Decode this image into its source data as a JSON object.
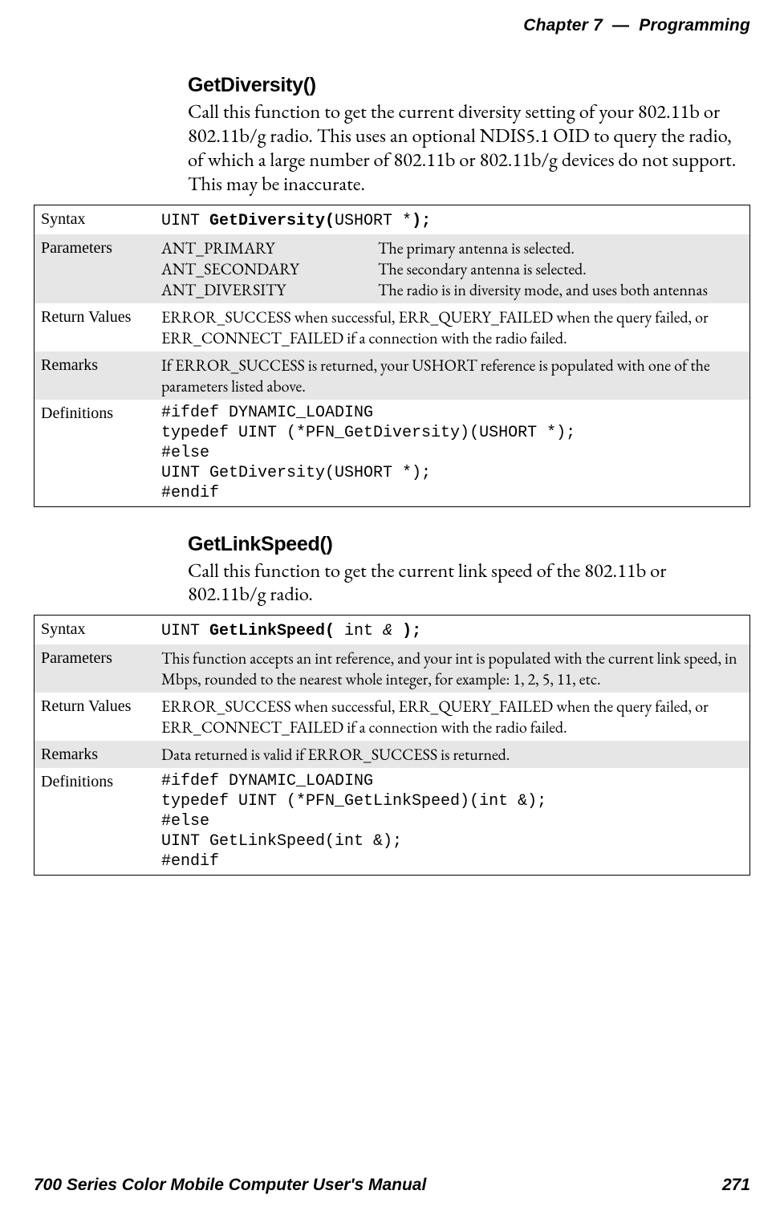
{
  "header": {
    "chapter_label": "Chapter",
    "chapter_num": "7",
    "dash": "—",
    "section": "Programming"
  },
  "func1": {
    "title": "GetDiversity()",
    "desc": "Call this function to get the current diversity setting of your 802.11b or 802.11b/g radio. This uses an optional NDIS5.1 OID to query the radio, of which a large number of 802.11b or 802.11b/g devices do not support. This may be inaccurate.",
    "rows": {
      "syntax_label": "Syntax",
      "syntax_pre": "UINT ",
      "syntax_bold1": "GetDiversity(",
      "syntax_mid": "USHORT *",
      "syntax_bold2": ");",
      "params_label": "Parameters",
      "params": [
        {
          "name": "ANT_PRIMARY",
          "desc": "The primary antenna is selected."
        },
        {
          "name": "ANT_SECONDARY",
          "desc": "The secondary antenna is selected."
        },
        {
          "name": "ANT_DIVERSITY",
          "desc": "The radio is in diversity mode, and uses both antennas"
        }
      ],
      "return_label": "Return Values",
      "return_text": "ERROR_SUCCESS when successful, ERR_QUERY_FAILED when the query failed, or ERR_CONNECT_FAILED if a connection with the radio failed.",
      "remarks_label": "Remarks",
      "remarks_text": "If ERROR_SUCCESS is returned, your USHORT reference is populated with one of the parameters listed above.",
      "defs_label": "Definitions",
      "defs_code": "#ifdef DYNAMIC_LOADING\ntypedef UINT (*PFN_GetDiversity)(USHORT *);\n#else\nUINT GetDiversity(USHORT *);\n#endif"
    }
  },
  "func2": {
    "title": "GetLinkSpeed()",
    "desc": "Call this function to get the current link speed of the 802.11b or 802.11b/g radio.",
    "rows": {
      "syntax_label": "Syntax",
      "syntax_pre": "UINT ",
      "syntax_bold1": "GetLinkSpeed(",
      "syntax_mid": " int ",
      "syntax_italic": "&",
      "syntax_space": " ",
      "syntax_bold2": ");",
      "params_label": "Parameters",
      "params_text": "This function accepts an int reference, and your int is populated with the current link speed, in Mbps, rounded to the nearest whole integer, for example: 1, 2, 5, 11, etc.",
      "return_label": "Return Values",
      "return_text": "ERROR_SUCCESS when successful, ERR_QUERY_FAILED when the query failed, or ERR_CONNECT_FAILED if a connection with the radio failed.",
      "remarks_label": "Remarks",
      "remarks_text": "Data returned is valid if ERROR_SUCCESS is returned.",
      "defs_label": "Definitions",
      "defs_code": "#ifdef DYNAMIC_LOADING\ntypedef UINT (*PFN_GetLinkSpeed)(int &);\n#else\nUINT GetLinkSpeed(int &);\n#endif"
    }
  },
  "footer": {
    "manual": "700 Series Color Mobile Computer User's Manual",
    "page": "271"
  }
}
